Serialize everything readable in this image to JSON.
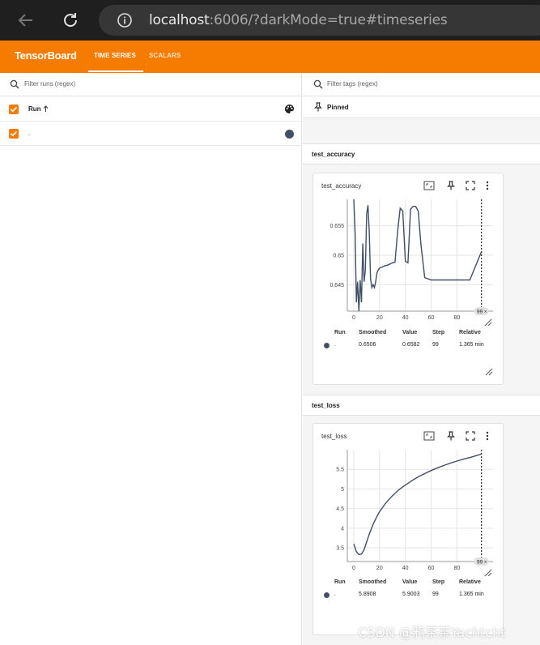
{
  "browser": {
    "url_host": "localhost",
    "url_rest": ":6006/?darkMode=true#timeseries"
  },
  "header": {
    "brand": "TensorBoard",
    "tabs": [
      "TIME SERIES",
      "SCALARS"
    ],
    "active_tab": "TIME SERIES",
    "color": "#f57c00"
  },
  "runs_panel": {
    "filter_placeholder": "Filter runs (regex)",
    "column_label": "Run",
    "runs": [
      {
        "name": ".",
        "checked": true,
        "color": "#425066"
      }
    ]
  },
  "tags_panel": {
    "filter_placeholder": "Filter tags (regex)",
    "pinned_label": "Pinned"
  },
  "groups": [
    {
      "name": "test_accuracy",
      "card_title": "test_accuracy",
      "step_badge": "99",
      "legend": {
        "headers": [
          "Run",
          "Smoothed",
          "Value",
          "Step",
          "Relative"
        ],
        "row": {
          "run": ".",
          "smoothed": "0.6506",
          "value": "0.6582",
          "step": "99",
          "relative": "1.365 min"
        }
      }
    },
    {
      "name": "test_loss",
      "card_title": "test_loss",
      "step_badge": "99",
      "legend": {
        "headers": [
          "Run",
          "Smoothed",
          "Value",
          "Step",
          "Relative"
        ],
        "row": {
          "run": ".",
          "smoothed": "5.8908",
          "value": "5.9003",
          "step": "99",
          "relative": "1.365 min"
        }
      }
    }
  ],
  "chart_data": [
    {
      "type": "line",
      "title": "test_accuracy",
      "x_ticks": [
        "0",
        "20",
        "40",
        "60",
        "80"
      ],
      "y_ticks": [
        "0.645",
        "0.65",
        "0.655"
      ],
      "xlim": [
        -5,
        108
      ],
      "ylim": [
        0.6405,
        0.6595
      ],
      "series": [
        {
          "color": "#425066",
          "x": [
            0,
            1,
            2,
            3,
            4,
            5,
            6,
            7,
            8,
            9,
            10,
            11,
            12,
            13,
            14,
            15,
            16,
            17,
            18,
            19,
            20,
            22,
            24,
            26,
            28,
            30,
            32,
            34,
            36,
            38,
            40,
            42,
            44,
            46,
            48,
            50,
            52,
            55,
            60,
            70,
            80,
            90,
            99
          ],
          "values": [
            0.6595,
            0.654,
            0.642,
            0.6455,
            0.64,
            0.6458,
            0.642,
            0.652,
            0.6455,
            0.6475,
            0.657,
            0.6585,
            0.654,
            0.646,
            0.6445,
            0.645,
            0.6445,
            0.6455,
            0.647,
            0.6475,
            0.6478,
            0.648,
            0.6482,
            0.6483,
            0.6485,
            0.6487,
            0.6488,
            0.654,
            0.658,
            0.6575,
            0.649,
            0.6487,
            0.6578,
            0.6583,
            0.6583,
            0.6575,
            0.652,
            0.6462,
            0.6458,
            0.6458,
            0.6458,
            0.6458,
            0.6506
          ]
        }
      ]
    },
    {
      "type": "line",
      "title": "test_loss",
      "x_ticks": [
        "0",
        "20",
        "40",
        "60",
        "80"
      ],
      "y_ticks": [
        "3.5",
        "4",
        "4.5",
        "5",
        "5.5"
      ],
      "xlim": [
        -5,
        108
      ],
      "ylim": [
        3.15,
        6.0
      ],
      "series": [
        {
          "color": "#425066",
          "x": [
            0,
            2,
            4,
            6,
            8,
            10,
            12,
            14,
            16,
            18,
            20,
            25,
            30,
            35,
            40,
            45,
            50,
            55,
            60,
            65,
            70,
            75,
            80,
            85,
            90,
            95,
            99
          ],
          "values": [
            3.6,
            3.4,
            3.33,
            3.34,
            3.45,
            3.65,
            3.85,
            4.02,
            4.17,
            4.3,
            4.42,
            4.65,
            4.83,
            4.98,
            5.1,
            5.21,
            5.31,
            5.39,
            5.47,
            5.54,
            5.6,
            5.66,
            5.71,
            5.76,
            5.8,
            5.85,
            5.89
          ]
        }
      ]
    }
  ]
}
